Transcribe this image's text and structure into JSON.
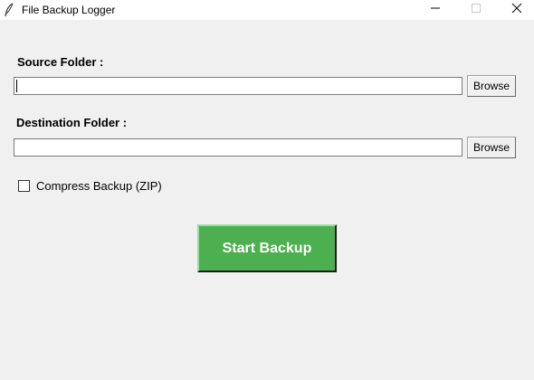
{
  "window": {
    "title": "File Backup Logger",
    "icon": "feather-icon",
    "controls": [
      "minimize-icon",
      "maximize-icon",
      "close-icon"
    ]
  },
  "source": {
    "label": "Source Folder :",
    "value": "",
    "browse_label": "Browse"
  },
  "destination": {
    "label": "Destination Folder :",
    "value": "",
    "browse_label": "Browse"
  },
  "compress": {
    "label": "Compress Backup (ZIP)",
    "checked": false
  },
  "start_button": {
    "label": "Start Backup",
    "color": "#4caf50"
  }
}
